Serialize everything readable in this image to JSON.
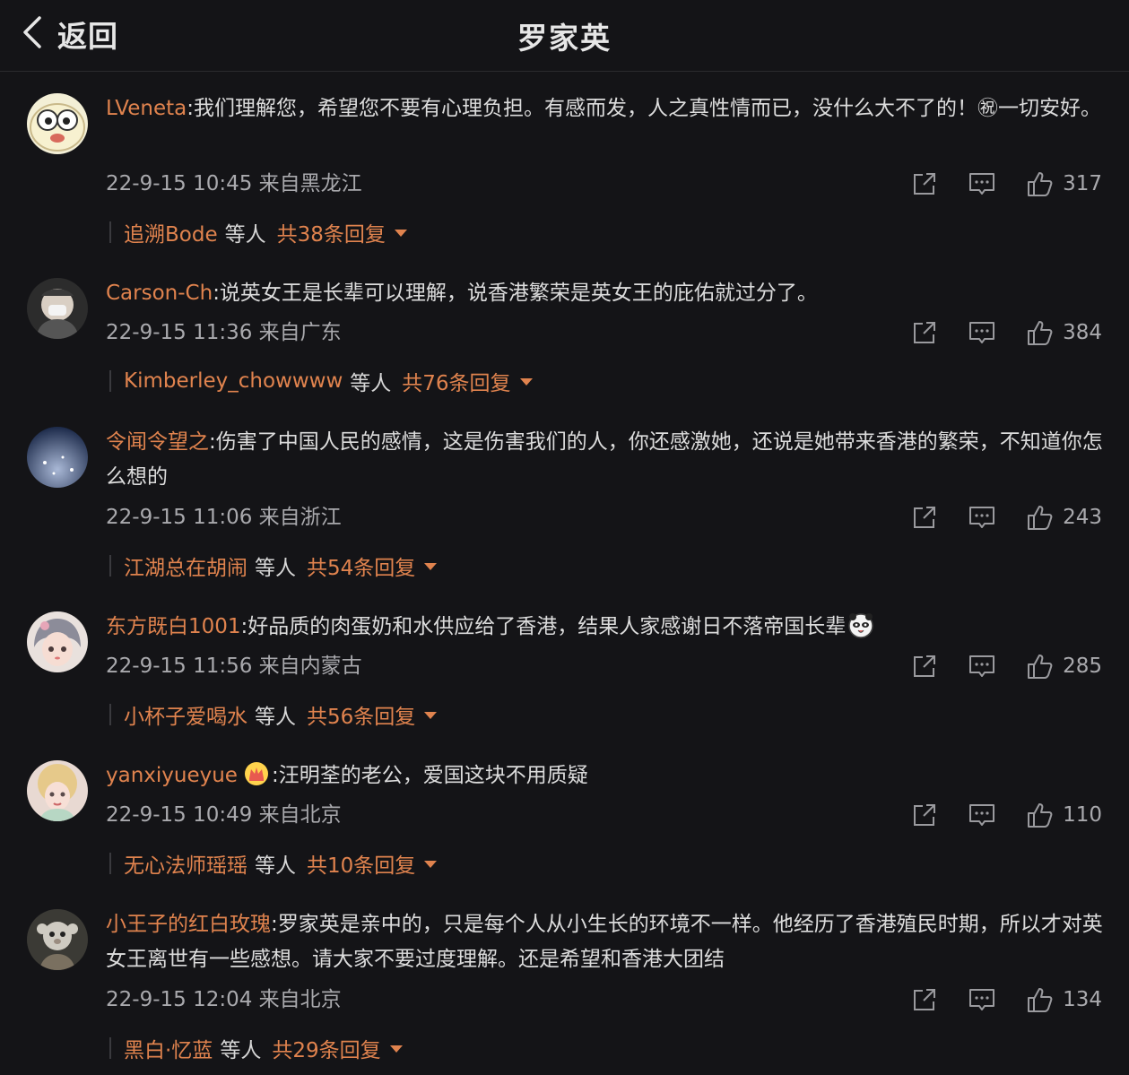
{
  "header": {
    "back_label": "返回",
    "title": "罗家英"
  },
  "comments": [
    {
      "user": "LVeneta",
      "text": ":我们理解您，希望您不要有心理负担。有感而发，人之真性情而已，没什么大不了的！㊗一切安好。",
      "time": "22-9-15 10:45",
      "location": "来自黑龙江",
      "likes": "317",
      "reply_user": "追溯Bode",
      "reply_etc": "等人",
      "reply_count": "共38条回复"
    },
    {
      "user": "Carson-Ch",
      "text": ":说英女王是长辈可以理解，说香港繁荣是英女王的庇佑就过分了。",
      "time": "22-9-15 11:36",
      "location": "来自广东",
      "likes": "384",
      "reply_user": "Kimberley_chowwww",
      "reply_etc": "等人",
      "reply_count": "共76条回复"
    },
    {
      "user": "令闻令望之",
      "text": ":伤害了中国人民的感情，这是伤害我们的人，你还感激她，还说是她带来香港的繁荣，不知道你怎么想的",
      "time": "22-9-15 11:06",
      "location": "来自浙江",
      "likes": "243",
      "reply_user": "江湖总在胡闹",
      "reply_etc": "等人",
      "reply_count": "共54条回复"
    },
    {
      "user": "东方既白1001",
      "text": ":好品质的肉蛋奶和水供应给了香港，结果人家感谢日不落帝国长辈",
      "time": "22-9-15 11:56",
      "location": "来自内蒙古",
      "likes": "285",
      "reply_user": "小杯子爱喝水",
      "reply_etc": "等人",
      "reply_count": "共56条回复"
    },
    {
      "user": "yanxiyueyue",
      "text": ":汪明荃的老公，爱国这块不用质疑",
      "time": "22-9-15 10:49",
      "location": "来自北京",
      "likes": "110",
      "reply_user": "无心法师瑶瑶",
      "reply_etc": "等人",
      "reply_count": "共10条回复"
    },
    {
      "user": "小王子的红白玫瑰",
      "text": ":罗家英是亲中的，只是每个人从小生长的环境不一样。他经历了香港殖民时期，所以才对英女王离世有一些感想。请大家不要过度理解。还是希望和香港大团结",
      "time": "22-9-15 12:04",
      "location": "来自北京",
      "likes": "134",
      "reply_user": "黑白·忆蓝",
      "reply_etc": "等人",
      "reply_count": "共29条回复"
    }
  ],
  "colors": {
    "background": "#141417",
    "accent": "#e0834e",
    "text": "#dcdcdc",
    "meta": "#a9a9ad"
  }
}
